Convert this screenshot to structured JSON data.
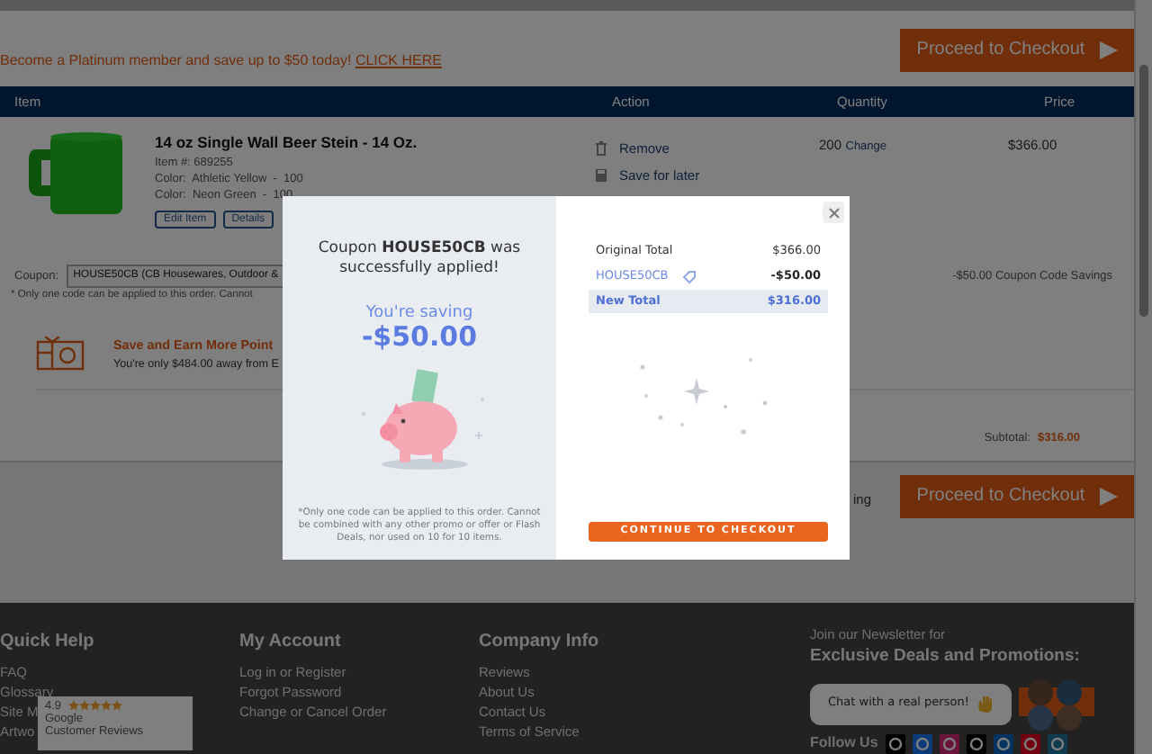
{
  "promo": {
    "text": "Become a Platinum member and save up to $50 today!",
    "link": "CLICK HERE"
  },
  "top_checkout": "Proceed to Checkout",
  "cart": {
    "columns": [
      "Item",
      "Action",
      "Quantity",
      "Price"
    ],
    "items": [
      {
        "title": "14 oz Single Wall Beer Stein - 14 Oz.",
        "item_number": "Item #: 689255",
        "colors": [
          "Color:  Athletic Yellow  -  100",
          "Color:  Neon Green  -  100"
        ],
        "buttons": [
          "Edit Item",
          "Details"
        ],
        "actions": [
          {
            "kind": "remove",
            "label": "Remove"
          },
          {
            "kind": "save",
            "label": "Save for later"
          }
        ],
        "quantity": "200",
        "change": "Change",
        "price": "$366.00"
      }
    ]
  },
  "coupon": {
    "label": "Coupon:",
    "value": "HOUSE50CB (CB Housewares, Outdoor &",
    "note": "* Only one code can be applied to this order. Cannot",
    "savings": "-$50.00 Coupon Code Savings"
  },
  "points": {
    "title": "Save and Earn More Point",
    "text": "You're only $484.00 away from E"
  },
  "subtotal": {
    "label": "Subtotal:",
    "value": "$316.00"
  },
  "bottom_text": "ing",
  "bottom_checkout": "Proceed to Checkout",
  "modal": {
    "heading": "Coupon **HOUSE50CB** was successfully applied!",
    "saving_label": "You're saving",
    "saving_amount": "-$50.00",
    "disclaimer": "*Only one code can be applied to this order. Cannot be combined with any other promo or offer or Flash Deals, nor used on 10 for 10 items.",
    "summary": [
      {
        "kind": "original",
        "label": "Original Total",
        "value": "$366.00"
      },
      {
        "kind": "coupon",
        "label": "HOUSE50CB",
        "value": "-$50.00"
      },
      {
        "kind": "total",
        "label": "New Total",
        "value": "$316.00"
      }
    ],
    "button": "CONTINUE TO CHECKOUT"
  },
  "footer": {
    "columns": [
      {
        "heading": "Quick Help",
        "links": [
          "FAQ",
          "Glossary",
          "Site M",
          "Artwo"
        ]
      },
      {
        "heading": "My Account",
        "links": [
          "Log in or Register",
          "Forgot Password",
          "Change or Cancel Order"
        ]
      },
      {
        "heading": "Company Info",
        "links": [
          "Reviews",
          "About Us",
          "Contact Us",
          "Terms of Service"
        ]
      }
    ],
    "newsletter": {
      "intro": "Join our Newsletter for",
      "title": "Exclusive Deals and Promotions:"
    },
    "chat": "Chat with a real person!",
    "follow": "Follow Us",
    "reviews": {
      "rating": "4.9",
      "stars": 5,
      "source": "Google",
      "label": "Customer Reviews"
    }
  }
}
